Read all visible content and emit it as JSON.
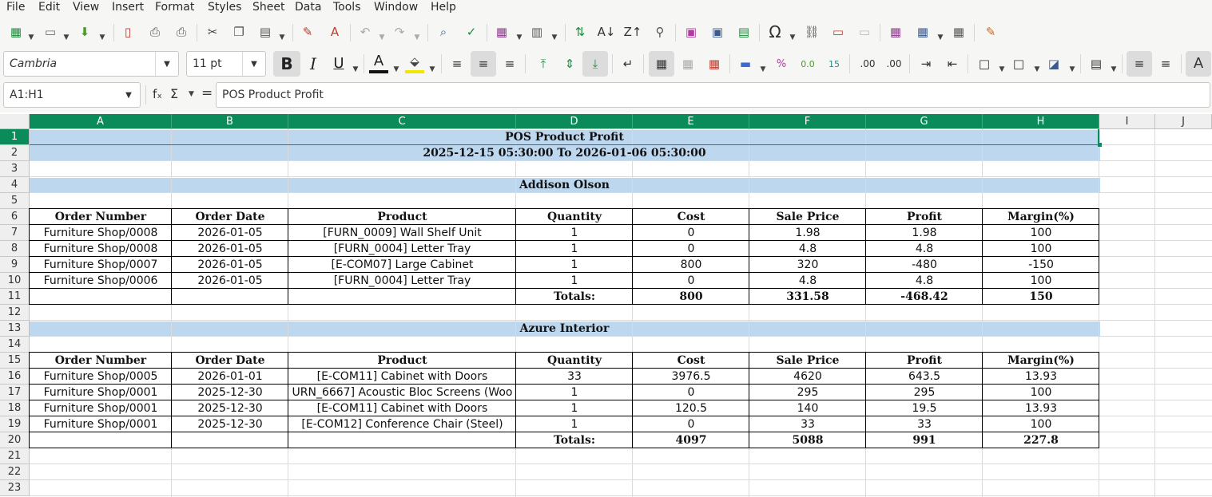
{
  "menu": [
    "File",
    "Edit",
    "View",
    "Insert",
    "Format",
    "Styles",
    "Sheet",
    "Data",
    "Tools",
    "Window",
    "Help"
  ],
  "toolbar": {
    "font_name": "Cambria",
    "font_size": "11 pt"
  },
  "formula_bar": {
    "name_box": "A1:H1",
    "fx": "fₓ",
    "sigma": "Σ",
    "equals": "=",
    "content": "POS Product Profit"
  },
  "columns": [
    "A",
    "B",
    "C",
    "D",
    "E",
    "F",
    "G",
    "H",
    "I",
    "J"
  ],
  "rows": [
    "1",
    "2",
    "3",
    "4",
    "5",
    "6",
    "7",
    "8",
    "9",
    "10",
    "11",
    "12",
    "13",
    "14",
    "15",
    "16",
    "17",
    "18",
    "19",
    "20",
    "21",
    "22",
    "23"
  ],
  "report": {
    "title": "POS Product Profit",
    "date_range": "2025-12-15 05:30:00 To 2026-01-06 05:30:00",
    "headers": [
      "Order Number",
      "Order Date",
      "Product",
      "Quantity",
      "Cost",
      "Sale Price",
      "Profit",
      "Margin(%)"
    ],
    "totals_label": "Totals:",
    "sections": [
      {
        "customer": "Addison Olson",
        "rows": [
          [
            "Furniture Shop/0008",
            "2026-01-05",
            "[FURN_0009] Wall Shelf Unit",
            "1",
            "0",
            "1.98",
            "1.98",
            "100"
          ],
          [
            "Furniture Shop/0008",
            "2026-01-05",
            "[FURN_0004] Letter Tray",
            "1",
            "0",
            "4.8",
            "4.8",
            "100"
          ],
          [
            "Furniture Shop/0007",
            "2026-01-05",
            "[E-COM07] Large Cabinet",
            "1",
            "800",
            "320",
            "-480",
            "-150"
          ],
          [
            "Furniture Shop/0006",
            "2026-01-05",
            "[FURN_0004] Letter Tray",
            "1",
            "0",
            "4.8",
            "4.8",
            "100"
          ]
        ],
        "totals": [
          "800",
          "331.58",
          "-468.42",
          "150"
        ]
      },
      {
        "customer": "Azure Interior",
        "rows": [
          [
            "Furniture Shop/0005",
            "2026-01-01",
            "[E-COM11] Cabinet with Doors",
            "33",
            "3976.5",
            "4620",
            "643.5",
            "13.93"
          ],
          [
            "Furniture Shop/0001",
            "2025-12-30",
            "URN_6667] Acoustic Bloc Screens (Woo",
            "1",
            "0",
            "295",
            "295",
            "100"
          ],
          [
            "Furniture Shop/0001",
            "2025-12-30",
            "[E-COM11] Cabinet with Doors",
            "1",
            "120.5",
            "140",
            "19.5",
            "13.93"
          ],
          [
            "Furniture Shop/0001",
            "2025-12-30",
            "[E-COM12] Conference Chair (Steel)",
            "1",
            "0",
            "33",
            "33",
            "100"
          ]
        ],
        "totals": [
          "4097",
          "5088",
          "991",
          "227.8"
        ]
      }
    ]
  },
  "colors": {
    "selection_header": "#0b8a5a",
    "band": "#bdd7ee",
    "toolbar_bg": "#f6f6f5"
  }
}
